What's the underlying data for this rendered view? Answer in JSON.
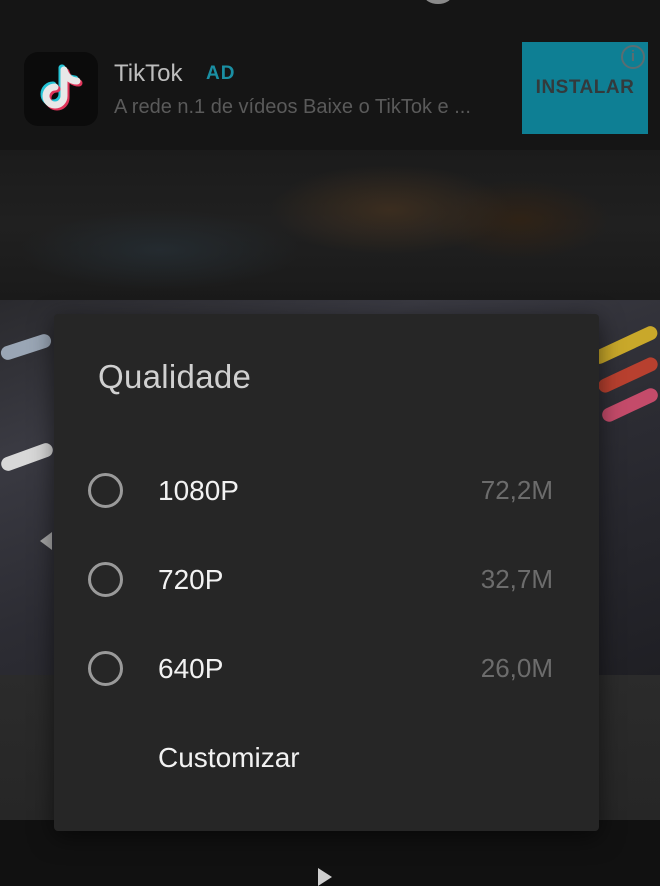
{
  "ad": {
    "app_name": "TikTok",
    "badge": "AD",
    "description": "A rede n.1 de vídeos Baixe o TikTok e ...",
    "install_label": "INSTALAR",
    "info_glyph": "i",
    "icon": "tiktok-logo-icon",
    "accent_color": "#0e7f94"
  },
  "dialog": {
    "title": "Qualidade",
    "options": [
      {
        "label": "1080P",
        "size": "72,2M",
        "selected": false
      },
      {
        "label": "720P",
        "size": "32,7M",
        "selected": false
      },
      {
        "label": "640P",
        "size": "26,0M",
        "selected": false
      }
    ],
    "custom_label": "Customizar"
  },
  "player": {
    "prev_icon": "chevron-left-icon",
    "play_icon": "play-icon"
  }
}
